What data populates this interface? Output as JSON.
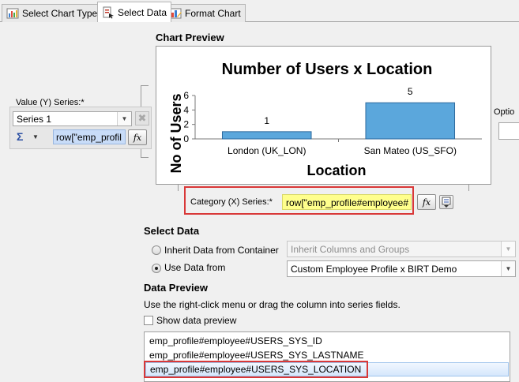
{
  "tabs": [
    {
      "label": "Select Chart Type",
      "icon": "chart-type-icon",
      "active": false
    },
    {
      "label": "Select Data",
      "icon": "select-data-icon",
      "active": true
    },
    {
      "label": "Format Chart",
      "icon": "format-chart-icon",
      "active": false
    }
  ],
  "chart_preview": {
    "title": "Chart Preview"
  },
  "chart_data": {
    "type": "bar",
    "title": "Number of Users x Location",
    "xlabel": "Location",
    "ylabel": "No of Users",
    "categories": [
      "London (UK_LON)",
      "San Mateo (US_SFO)"
    ],
    "values": [
      1,
      5
    ],
    "data_labels": [
      "1",
      "5"
    ],
    "yticks": [
      0,
      2,
      4,
      6
    ],
    "ylim": [
      0,
      6
    ],
    "bar_color": "#5ba7dc"
  },
  "value_series": {
    "label": "Value (Y) Series:*",
    "series_selected": "Series 1",
    "sigma": "Σ",
    "expression": "row[\"emp_profil",
    "fx": "fx"
  },
  "options_label": "Optio",
  "category_series": {
    "label": "Category (X) Series:*",
    "expression": "row[\"emp_profile#employee#",
    "fx": "fx"
  },
  "select_data": {
    "title": "Select Data",
    "inherit_label": "Inherit Data from Container",
    "inherit_value": "Inherit Columns and Groups",
    "use_label": "Use Data from",
    "use_value": "Custom Employee Profile x BIRT Demo"
  },
  "data_preview": {
    "title": "Data Preview",
    "hint": "Use the right-click menu or drag the column into series fields.",
    "show_label": "Show data preview",
    "columns": [
      "emp_profile#employee#USERS_SYS_ID",
      "emp_profile#employee#USERS_SYS_LASTNAME",
      "emp_profile#employee#USERS_SYS_LOCATION"
    ]
  },
  "colors": {
    "highlight_red": "#d93838",
    "expr_yellow": "#ffff8c",
    "expr_blue": "#c8dcf8"
  }
}
